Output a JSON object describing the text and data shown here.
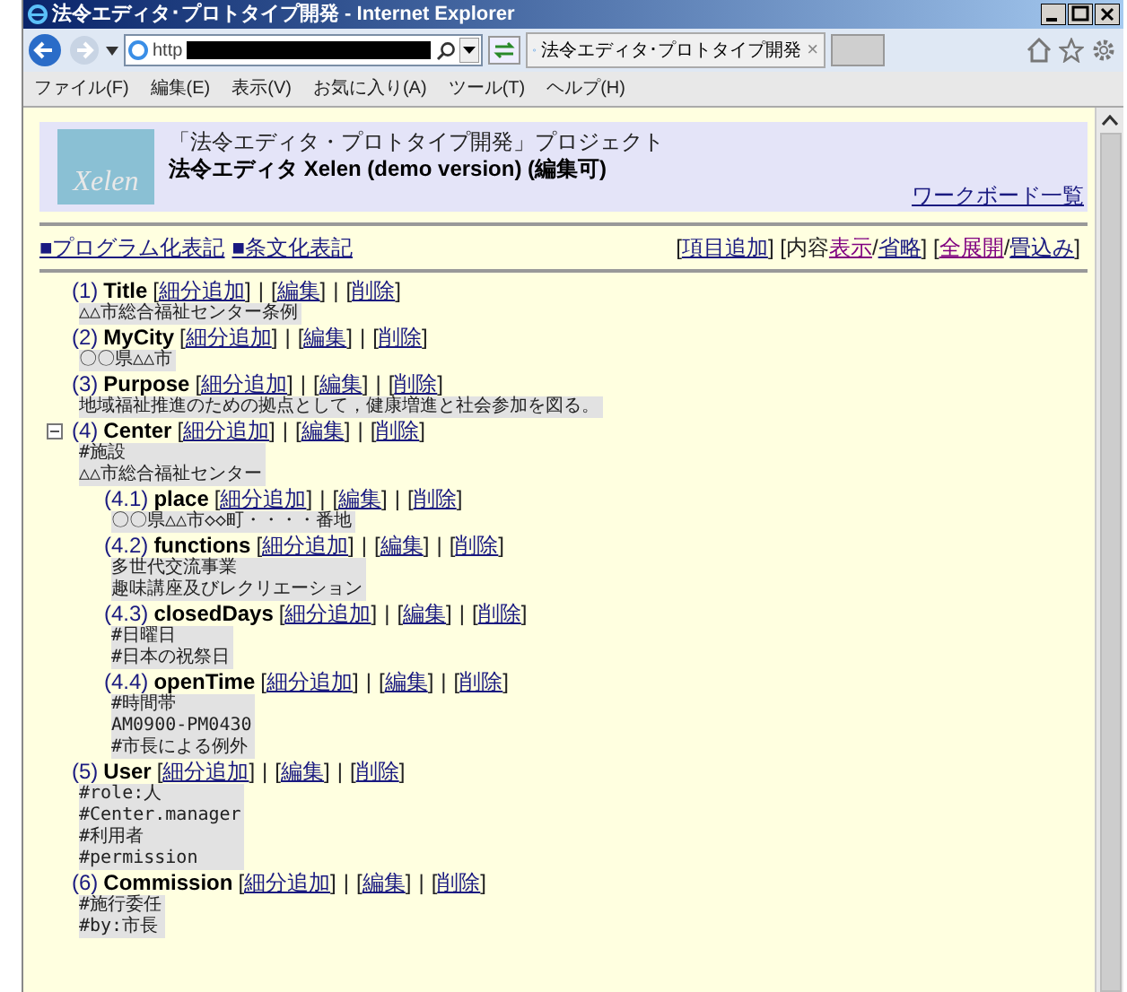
{
  "window": {
    "title": "法令エディタ･プロトタイプ開発 - Internet Explorer"
  },
  "address_bar": {
    "value": "http"
  },
  "tab": {
    "title": "法令エディタ･プロトタイプ開発",
    "close": "×"
  },
  "menu": [
    "ファイル(F)",
    "編集(E)",
    "表示(V)",
    "お気に入り(A)",
    "ツール(T)",
    "ヘルプ(H)"
  ],
  "header": {
    "logo": "Xelen",
    "project": "「法令エディタ・プロトタイプ開発」プロジェクト",
    "app_title": "法令エディタ Xelen (demo version) (**編集可**)",
    "link": "ワークボード一覧"
  },
  "view_links": [
    "■プログラム化表記",
    "■条文化表記"
  ],
  "toolbar": [
    {
      "kind": "text",
      "text": "["
    },
    {
      "kind": "link",
      "text": "項目追加",
      "visited": false
    },
    {
      "kind": "text",
      "text": "] [内容"
    },
    {
      "kind": "link",
      "text": "表示",
      "visited": true
    },
    {
      "kind": "text",
      "text": "/"
    },
    {
      "kind": "link",
      "text": "省略",
      "visited": false
    },
    {
      "kind": "text",
      "text": "] ["
    },
    {
      "kind": "link",
      "text": "全展開",
      "visited": true
    },
    {
      "kind": "text",
      "text": "/"
    },
    {
      "kind": "link",
      "text": "畳込み",
      "visited": false
    },
    {
      "kind": "text",
      "text": "]"
    }
  ],
  "action_syntax": {
    "open": "[",
    "close": "]",
    "separator": "|"
  },
  "items": [
    {
      "number": "(1)",
      "name": "Title",
      "actions": [
        "細分追加",
        "編集",
        "削除"
      ],
      "content": [
        "△△市総合福祉センター条例"
      ]
    },
    {
      "number": "(2)",
      "name": "MyCity",
      "actions": [
        "細分追加",
        "編集",
        "削除"
      ],
      "content": [
        "〇〇県△△市"
      ]
    },
    {
      "number": "(3)",
      "name": "Purpose",
      "actions": [
        "細分追加",
        "編集",
        "削除"
      ],
      "content": [
        "地域福祉推進のための拠点として，健康増進と社会参加を図る。"
      ]
    },
    {
      "number": "(4)",
      "name": "Center",
      "expanded": true,
      "actions": [
        "細分追加",
        "編集",
        "削除"
      ],
      "content": [
        "#施設",
        "△△市総合福祉センター"
      ],
      "children": [
        {
          "number": "(4.1)",
          "name": "place",
          "actions": [
            "細分追加",
            "編集",
            "削除"
          ],
          "content": [
            "〇〇県△△市◇◇町・・・・番地"
          ]
        },
        {
          "number": "(4.2)",
          "name": "functions",
          "actions": [
            "細分追加",
            "編集",
            "削除"
          ],
          "content": [
            "多世代交流事業",
            "趣味講座及びレクリエーション"
          ]
        },
        {
          "number": "(4.3)",
          "name": "closedDays",
          "actions": [
            "細分追加",
            "編集",
            "削除"
          ],
          "content": [
            "#日曜日",
            "#日本の祝祭日"
          ]
        },
        {
          "number": "(4.4)",
          "name": "openTime",
          "actions": [
            "細分追加",
            "編集",
            "削除"
          ],
          "content": [
            "#時間帯",
            "AM0900-PM0430",
            "#市長による例外"
          ]
        }
      ]
    },
    {
      "number": "(5)",
      "name": "User",
      "actions": [
        "細分追加",
        "編集",
        "削除"
      ],
      "content": [
        "#role:人",
        "#Center.manager",
        "#利用者",
        "#permission"
      ]
    },
    {
      "number": "(6)",
      "name": "Commission",
      "actions": [
        "細分追加",
        "編集",
        "削除"
      ],
      "content": [
        "#施行委任",
        "#by:市長"
      ]
    }
  ]
}
